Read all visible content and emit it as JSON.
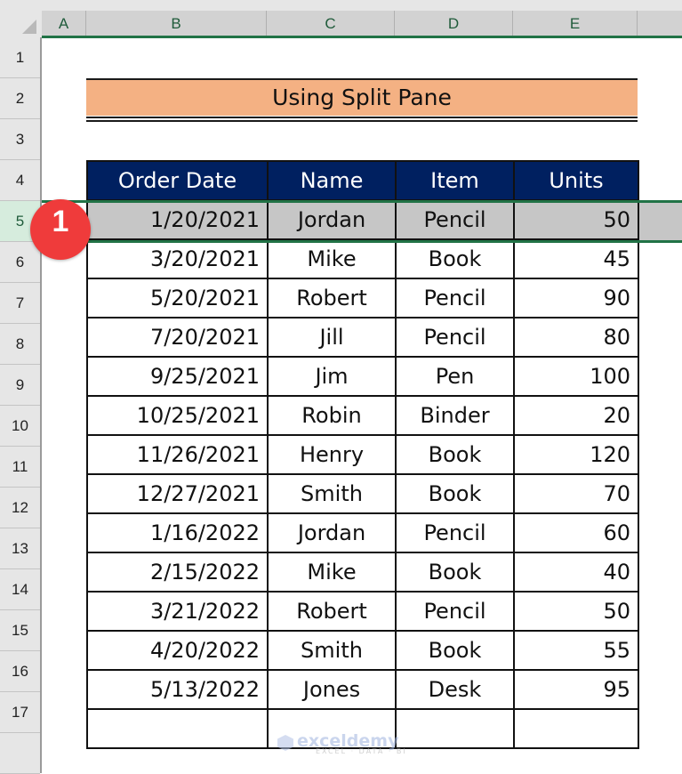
{
  "columns": [
    "A",
    "B",
    "C",
    "D",
    "E"
  ],
  "rows": [
    "1",
    "2",
    "3",
    "4",
    "5",
    "6",
    "7",
    "8",
    "9",
    "10",
    "11",
    "12",
    "13",
    "14",
    "15",
    "16",
    "17",
    ""
  ],
  "selected_row": "5",
  "title": "Using Split Pane",
  "table": {
    "headers": [
      "Order Date",
      "Name",
      "Item",
      "Units"
    ],
    "rows": [
      [
        "1/20/2021",
        "Jordan",
        "Pencil",
        "50"
      ],
      [
        "3/20/2021",
        "Mike",
        "Book",
        "45"
      ],
      [
        "5/20/2021",
        "Robert",
        "Pencil",
        "90"
      ],
      [
        "7/20/2021",
        "Jill",
        "Pencil",
        "80"
      ],
      [
        "9/25/2021",
        "Jim",
        "Pen",
        "100"
      ],
      [
        "10/25/2021",
        "Robin",
        "Binder",
        "20"
      ],
      [
        "11/26/2021",
        "Henry",
        "Book",
        "120"
      ],
      [
        "12/27/2021",
        "Smith",
        "Book",
        "70"
      ],
      [
        "1/16/2022",
        "Jordan",
        "Pencil",
        "60"
      ],
      [
        "2/15/2022",
        "Mike",
        "Book",
        "40"
      ],
      [
        "3/21/2022",
        "Robert",
        "Pencil",
        "50"
      ],
      [
        "4/20/2022",
        "Smith",
        "Book",
        "55"
      ],
      [
        "5/13/2022",
        "Jones",
        "Desk",
        "95"
      ],
      [
        "",
        "",
        "",
        ""
      ]
    ]
  },
  "step_badge": "1",
  "watermark": {
    "name": "exceldemy",
    "tagline": "EXCEL · DATA · BI"
  },
  "colors": {
    "title_fill": "#f4b183",
    "header_fill": "#002060",
    "selection_fill": "#c6c6c6",
    "split_line": "#217346",
    "badge": "#ef3b3b"
  }
}
